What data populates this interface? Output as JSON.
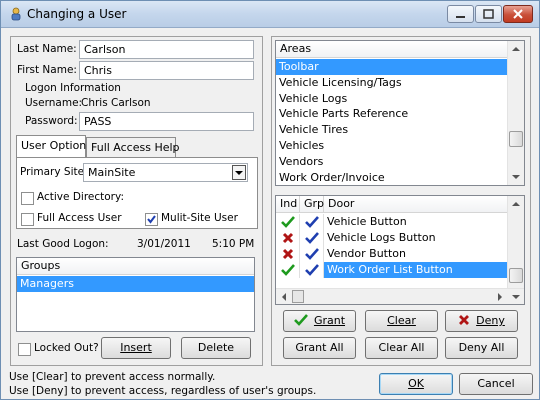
{
  "window": {
    "title": "Changing a User",
    "icon": "user-key-icon"
  },
  "user": {
    "last_name_label": "Last Name:",
    "last_name": "Carlson",
    "first_name_label": "First Name:",
    "first_name": "Chris",
    "logon_info_label": "Logon Information",
    "username_label": "Username:",
    "username": "Chris Carlson",
    "password_label": "Password:",
    "password": "PASS"
  },
  "tabs": [
    {
      "label": "User Options"
    },
    {
      "label": "Full Access Help"
    }
  ],
  "options": {
    "primary_site_label": "Primary Site:",
    "primary_site": "MainSite",
    "active_directory_label": "Active Directory:",
    "active_directory": false,
    "full_access_label": "Full Access User",
    "full_access": false,
    "multisite_label": "Mulit-Site User",
    "multisite": true
  },
  "last_logon": {
    "label": "Last Good Logon:",
    "date": "3/01/2011",
    "time": "5:10 PM"
  },
  "groups": {
    "header": "Groups",
    "items": [
      "Managers"
    ]
  },
  "locked": {
    "label": "Locked Out?",
    "value": false
  },
  "buttons": {
    "insert": "Insert",
    "delete": "Delete",
    "grant": "Grant",
    "clear": "Clear",
    "deny": "Deny",
    "grant_all": "Grant All",
    "clear_all": "Clear All",
    "deny_all": "Deny All",
    "ok": "OK",
    "cancel": "Cancel"
  },
  "areas": {
    "header": "Areas",
    "items": [
      "Toolbar",
      "Vehicle Licensing/Tags",
      "Vehicle Logs",
      "Vehicle Parts Reference",
      "Vehicle Tires",
      "Vehicles",
      "Vendors",
      "Work Order/Invoice"
    ],
    "selected": "Toolbar"
  },
  "doors": {
    "headers": {
      "ind": "Ind",
      "grp": "Grp",
      "door": "Door"
    },
    "rows": [
      {
        "ind": "grant",
        "grp": "grant",
        "door": "Vehicle Button"
      },
      {
        "ind": "deny",
        "grp": "grant",
        "door": "Vehicle Logs Button"
      },
      {
        "ind": "deny",
        "grp": "grant",
        "door": "Vendor Button"
      },
      {
        "ind": "grant",
        "grp": "grant",
        "door": "Work Order List Button"
      }
    ],
    "selected": "Work Order List Button"
  },
  "status": {
    "line1": "Use [Clear] to prevent access normally.",
    "line2": "Use [Deny] to prevent access, regardless of user's groups."
  },
  "colors": {
    "grant": "#1e9a1e",
    "deny": "#b01515",
    "grp_check": "#1f3fb0",
    "selection": "#3399ff"
  }
}
